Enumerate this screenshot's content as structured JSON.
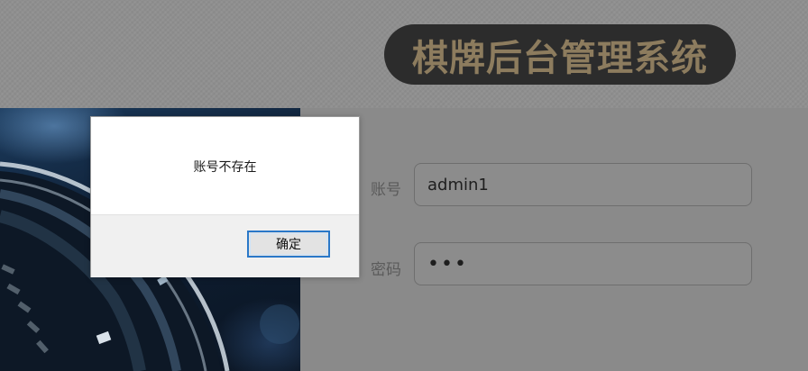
{
  "header": {
    "title": "棋牌后台管理系统"
  },
  "login_form": {
    "account_label": "账号",
    "account_value": "admin1",
    "password_label": "密码",
    "password_mask": "•••"
  },
  "alert_dialog": {
    "message": "账号不存在",
    "ok_label": "确定"
  },
  "colors": {
    "title_pill": "#2c2c2c",
    "title_text": "#8d7c5e",
    "dialog_focus_border": "#2a78c8",
    "overlay_gray": "#8a8a8a"
  }
}
